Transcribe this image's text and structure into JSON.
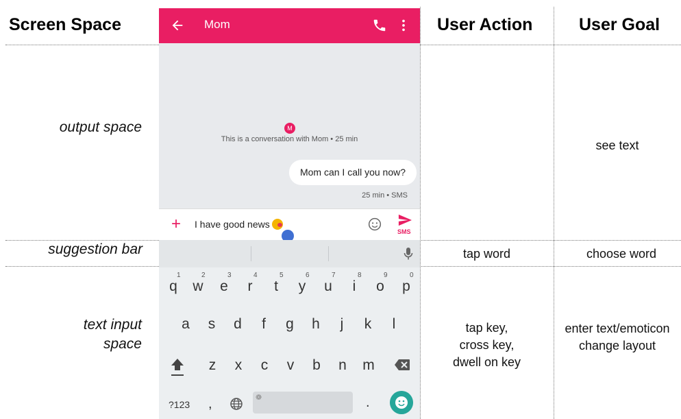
{
  "headers": {
    "screen_space": "Screen Space",
    "user_action": "User Action",
    "user_goal": "User Goal"
  },
  "rows": [
    {
      "label_lines": [
        "output space"
      ],
      "action_lines": [],
      "goal_lines": [
        "see text"
      ]
    },
    {
      "label_lines": [
        "suggestion bar"
      ],
      "action_lines": [
        "tap word"
      ],
      "goal_lines": [
        "choose word"
      ]
    },
    {
      "label_lines": [
        "text input",
        "space"
      ],
      "action_lines": [
        "tap key,",
        "cross key,",
        "dwell on key"
      ],
      "goal_lines": [
        "enter text/emoticon",
        "change layout"
      ]
    }
  ],
  "phone": {
    "appbar_title": "Mom",
    "appbar_color": "#e91e63",
    "icons": [
      "back-arrow-icon",
      "phone-icon",
      "more-vert-icon"
    ],
    "avatar_letter": "M",
    "conversation_info": "This is a conversation with Mom • 25 min",
    "bubble_text": "Mom can I call you now?",
    "bubble_meta": "25 min • SMS",
    "compose_plus": "+",
    "compose_text": "I have good news",
    "send_label": "SMS",
    "keyboard": {
      "row1": [
        "q",
        "w",
        "e",
        "r",
        "t",
        "y",
        "u",
        "i",
        "o",
        "p"
      ],
      "row1_numbers": [
        "1",
        "2",
        "3",
        "4",
        "5",
        "6",
        "7",
        "8",
        "9",
        "0"
      ],
      "row2": [
        "a",
        "s",
        "d",
        "f",
        "g",
        "h",
        "j",
        "k",
        "l"
      ],
      "row3": [
        "z",
        "x",
        "c",
        "v",
        "b",
        "n",
        "m"
      ],
      "symbols_key": "?123",
      "comma_key": ",",
      "period_key": ".",
      "emoji_key_color": "#26a69a"
    }
  }
}
